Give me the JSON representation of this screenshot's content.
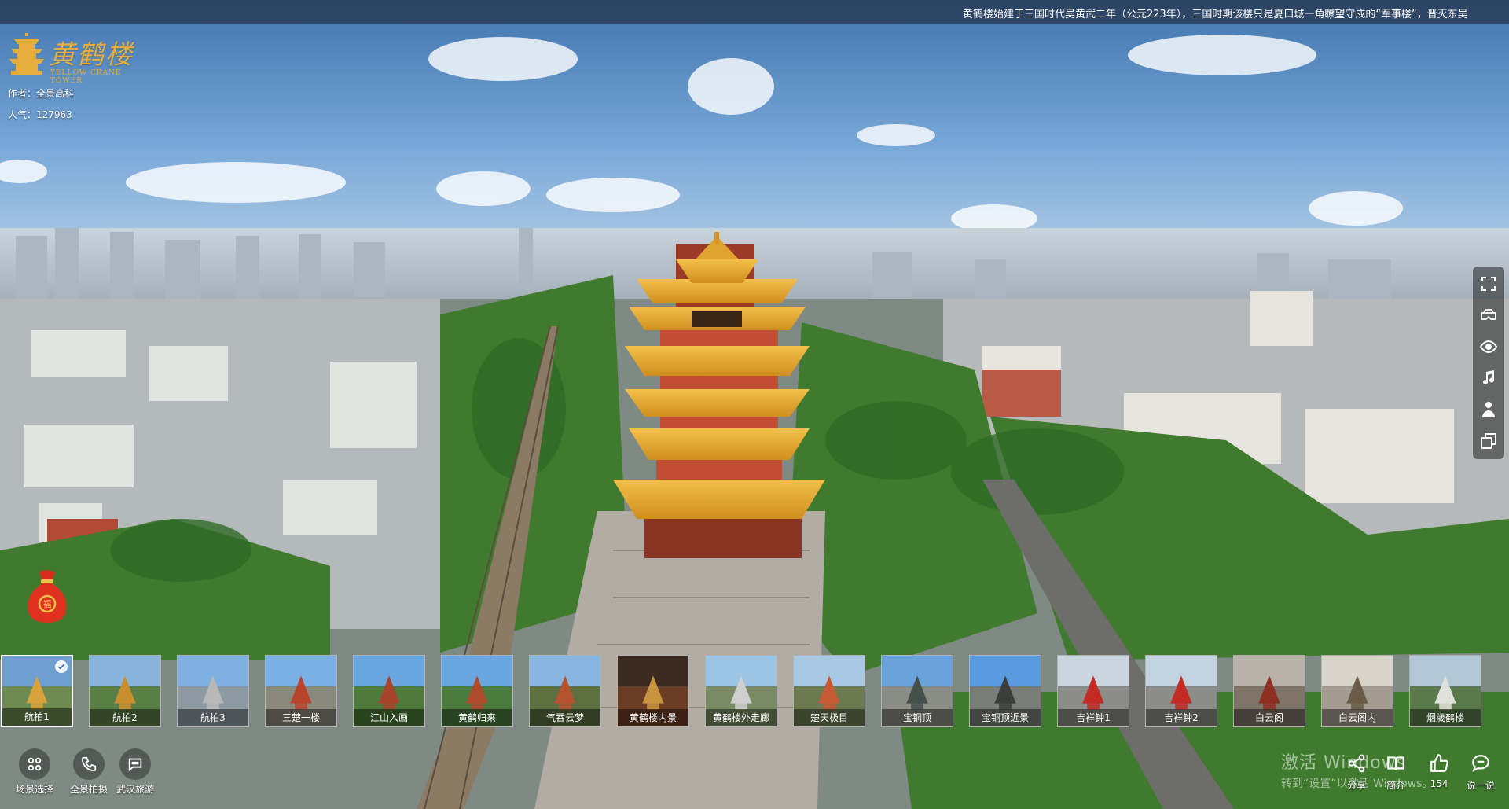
{
  "marquee": {
    "text": "黄鹤楼始建于三国时代吴黄武二年（公元223年），三国时期该楼只是夏口城一角瞭望守戍的“军事楼”，晋灭东吴"
  },
  "brand": {
    "title": "黄鹤楼",
    "subtitle": "YELLOW CRANE TOWER",
    "color": "#e6ad3c"
  },
  "info": {
    "author": "作者：全景高科",
    "popularity": "人气：127963"
  },
  "right_toolbar": {
    "items": [
      {
        "icon": "fullscreen-icon"
      },
      {
        "icon": "vr-glasses-icon"
      },
      {
        "icon": "eye-icon"
      },
      {
        "icon": "music-icon"
      },
      {
        "icon": "person-icon"
      },
      {
        "icon": "window-switch-icon"
      }
    ]
  },
  "scenes": [
    {
      "label": "航拍1",
      "active": true,
      "sky": "#6f9fd0",
      "ground": "#6c8a52",
      "accent": "#d9a23c"
    },
    {
      "label": "航拍2",
      "active": false,
      "sky": "#88b4dc",
      "ground": "#5a7f46",
      "accent": "#c98e2e"
    },
    {
      "label": "航拍3",
      "active": false,
      "sky": "#7fb0e0",
      "ground": "#8e9aa2",
      "accent": "#b8b8b8"
    },
    {
      "label": "三楚一楼",
      "active": false,
      "sky": "#7ab0e4",
      "ground": "#8a8a7c",
      "accent": "#b8442e"
    },
    {
      "label": "江山入画",
      "active": false,
      "sky": "#6aa7e0",
      "ground": "#4d7a3a",
      "accent": "#a8432d"
    },
    {
      "label": "黄鹤归来",
      "active": false,
      "sky": "#6aa7e0",
      "ground": "#4a7a3e",
      "accent": "#b04a2c"
    },
    {
      "label": "气吞云梦",
      "active": false,
      "sky": "#88b6e0",
      "ground": "#5e7040",
      "accent": "#b5532f"
    },
    {
      "label": "黄鹤楼内景",
      "active": false,
      "sky": "#3a2a20",
      "ground": "#6a3c24",
      "accent": "#c99440"
    },
    {
      "label": "黄鹤楼外走廊",
      "active": false,
      "sky": "#9cc4e4",
      "ground": "#7a8a62",
      "accent": "#cfcfcf"
    },
    {
      "label": "楚天极目",
      "active": false,
      "sky": "#a8c8e4",
      "ground": "#6d7a50",
      "accent": "#c55a34"
    },
    {
      "label": "宝铜顶",
      "active": false,
      "sky": "#6aa2dc",
      "ground": "#8a8c86",
      "accent": "#44504c"
    },
    {
      "label": "宝铜顶近景",
      "active": false,
      "sky": "#5a9ade",
      "ground": "#7a7e78",
      "accent": "#3a3e3c"
    },
    {
      "label": "吉祥钟1",
      "active": false,
      "sky": "#c9d6e0",
      "ground": "#8c8c88",
      "accent": "#c42a24"
    },
    {
      "label": "吉祥钟2",
      "active": false,
      "sky": "#c2d2de",
      "ground": "#8c8c88",
      "accent": "#c42a24"
    },
    {
      "label": "白云阁",
      "active": false,
      "sky": "#b9b2a8",
      "ground": "#7e7468",
      "accent": "#8e2f22"
    },
    {
      "label": "白云阁内",
      "active": false,
      "sky": "#d9d4ca",
      "ground": "#a49c90",
      "accent": "#6a5c48"
    },
    {
      "label": "烟歲鹤楼",
      "active": false,
      "sky": "#b2c8d6",
      "ground": "#5a7a4c",
      "accent": "#e0e0dc"
    }
  ],
  "bottom_left": {
    "scene_select": "场景选择",
    "panorama_shoot": "全景拍摄",
    "wuhan_travel": "武汉旅游"
  },
  "watermark": {
    "line1": "激活 Windows",
    "line2": "转到“设置”以激活 Windows。"
  },
  "bottom_right": {
    "share": "分享",
    "intro": "简介",
    "likes": "154",
    "comment": "说一说"
  }
}
